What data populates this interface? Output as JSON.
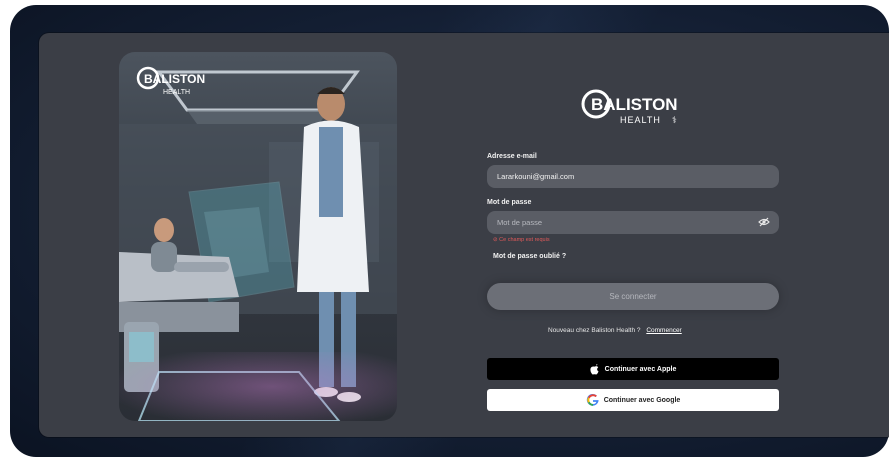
{
  "brand": {
    "name": "BALISTON",
    "sub": "HEALTH"
  },
  "form": {
    "email_label": "Adresse e-mail",
    "email_value": "Lararkouni@gmail.com",
    "password_label": "Mot de passe",
    "password_placeholder": "Mot de passe",
    "password_error": "⊘ Ce champ est requis",
    "forgot_link": "Mot de passe oublié ?",
    "submit_label": "Se connecter",
    "signup_prompt": "Nouveau chez Baliston Health ?",
    "signup_link": "Commencer"
  },
  "social": {
    "apple_label": "Continuer avec Apple",
    "google_label": "Continuer avec Google"
  },
  "colors": {
    "panel": "#3b3e46",
    "field": "#5a5d65",
    "error": "#e25a5a"
  }
}
